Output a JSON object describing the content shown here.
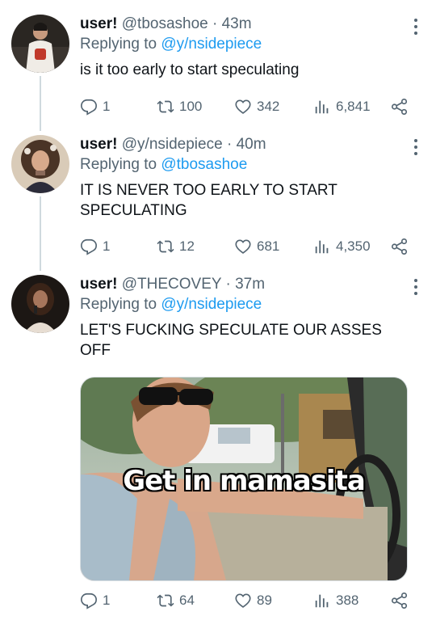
{
  "tweets": [
    {
      "name": "user!",
      "handle": "@tbosashoe",
      "dot": "·",
      "time": "43m",
      "reply_prefix": "Replying to",
      "reply_to": "@y/nsidepiece",
      "text": "is it too early to start speculating",
      "replies": "1",
      "retweets": "100",
      "likes": "342",
      "views": "6,841"
    },
    {
      "name": "user!",
      "handle": "@y/nsidepiece",
      "dot": "·",
      "time": "40m",
      "reply_prefix": "Replying to",
      "reply_to": "@tbosashoe",
      "text_line1": "IT IS NEVER TOO EARLY TO START",
      "text_line2": "SPECULATING",
      "replies": "1",
      "retweets": "12",
      "likes": "681",
      "views": "4,350"
    },
    {
      "name": "user!",
      "handle": "@THECOVEY",
      "dot": "·",
      "time": "37m",
      "reply_prefix": "Replying to",
      "reply_to": "@y/nsidepiece",
      "text_line1": "LET'S FUCKING SPECULATE OUR ASSES",
      "text_line2": "OFF",
      "media_caption": "Get in mamasita",
      "replies": "1",
      "retweets": "64",
      "likes": "89",
      "views": "388"
    }
  ],
  "icons": {
    "reply": "reply-icon",
    "retweet": "retweet-icon",
    "like": "heart-icon",
    "views": "views-icon",
    "share": "share-icon",
    "more": "more-icon"
  },
  "colors": {
    "text": "#0f1419",
    "secondary": "#536471",
    "link": "#1d9bf0",
    "thread_line": "#cfd9de"
  }
}
